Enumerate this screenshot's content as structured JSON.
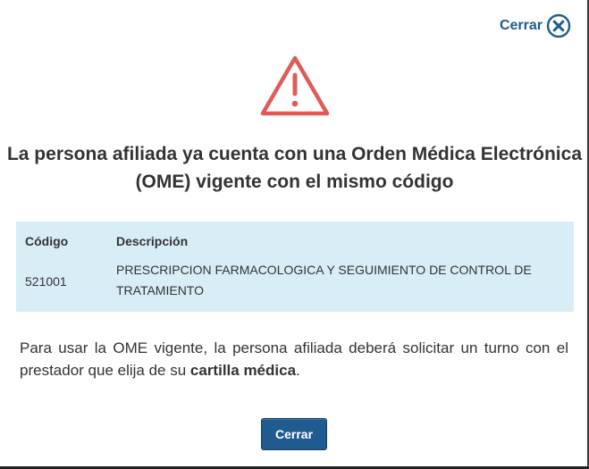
{
  "dialog": {
    "close_link_label": "Cerrar",
    "title": "La persona afiliada ya cuenta con una Orden Médica Electrónica (OME) vigente con el mismo código",
    "table": {
      "headers": [
        "Código",
        "Descripción"
      ],
      "rows": [
        {
          "code": "521001",
          "description": "PRESCRIPCION FARMACOLOGICA Y SEGUIMIENTO DE CONTROL DE TRATAMIENTO"
        }
      ]
    },
    "info_text_before": "Para usar la OME vigente, la persona afiliada deberá solicitar un turno con el prestador que elija de su ",
    "info_text_bold": "cartilla médica",
    "info_text_after": ".",
    "close_button_label": "Cerrar"
  },
  "colors": {
    "accent": "#1f5d8f",
    "warning": "#e05a5a",
    "table_background": "#d9edf7",
    "button_background": "#1f5a90"
  },
  "icons": {
    "close": "close-circle-icon",
    "warning": "warning-triangle-icon"
  }
}
